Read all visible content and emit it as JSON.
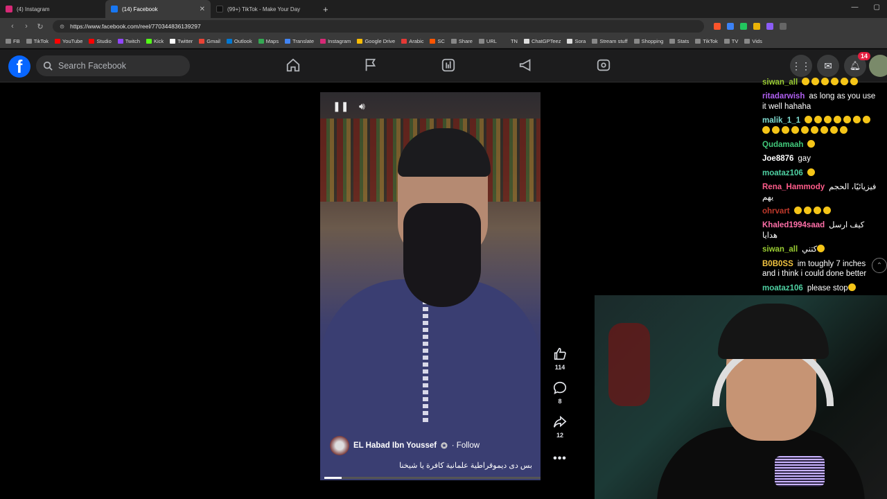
{
  "browser": {
    "tabs": [
      {
        "title": "(4) Instagram",
        "color": "#d62976"
      },
      {
        "title": "(14) Facebook",
        "color": "#1877f2",
        "active": true
      },
      {
        "title": "(99+) TikTok - Make Your Day",
        "color": "#111111"
      }
    ],
    "url": "https://www.facebook.com/reel/770344836139297",
    "bookmarks": [
      {
        "label": "FB",
        "color": "#888"
      },
      {
        "label": "TikTok",
        "color": "#888"
      },
      {
        "label": "YouTube",
        "color": "#ff0000"
      },
      {
        "label": "Studio",
        "color": "#ff0000"
      },
      {
        "label": "Twitch",
        "color": "#9146ff"
      },
      {
        "label": "Kick",
        "color": "#53fc18"
      },
      {
        "label": "Twitter",
        "color": "#ffffff"
      },
      {
        "label": "Gmail",
        "color": "#ea4335"
      },
      {
        "label": "Outlook",
        "color": "#0078d4"
      },
      {
        "label": "Maps",
        "color": "#34a853"
      },
      {
        "label": "Translate",
        "color": "#4285f4"
      },
      {
        "label": "Instagram",
        "color": "#d62976"
      },
      {
        "label": "Google Drive",
        "color": "#fbbc04"
      },
      {
        "label": "Arabic",
        "color": "#e53935"
      },
      {
        "label": "SC",
        "color": "#ff5500"
      },
      {
        "label": "Share",
        "color": "#888"
      },
      {
        "label": "URL",
        "color": "#888"
      },
      {
        "label": "TN",
        "color": "#3a3a3a"
      },
      {
        "label": "ChatGPTeez",
        "color": "#ddd"
      },
      {
        "label": "Sora",
        "color": "#ddd"
      },
      {
        "label": "Stream stuff",
        "color": "#888"
      },
      {
        "label": "Shopping",
        "color": "#888"
      },
      {
        "label": "Stats",
        "color": "#888"
      },
      {
        "label": "TikTok",
        "color": "#888"
      },
      {
        "label": "TV",
        "color": "#888"
      },
      {
        "label": "Vids",
        "color": "#888"
      }
    ]
  },
  "facebook": {
    "search_placeholder": "Search Facebook",
    "notifications_badge": "14",
    "reel": {
      "owner": "EL Habad Ibn Youssef",
      "follow_label": "· Follow",
      "caption": "بس دى ديموقراطية علمانية كافرة يا شيخنا",
      "likes": "114",
      "comments": "8",
      "shares": "12",
      "progress": 0.08
    }
  },
  "chat": [
    {
      "user": "siwan_all",
      "color": "#9acd32",
      "text": "",
      "emotes": 6
    },
    {
      "user": "ritadarwish",
      "color": "#b05ff0",
      "text": "as long as you use it well hahaha",
      "emotes": 0
    },
    {
      "user": "malik_1_1",
      "color": "#7fdcd0",
      "text": "",
      "emotes": 16
    },
    {
      "user": "Qudamaah",
      "color": "#41c87a",
      "text": "",
      "emotes": 1
    },
    {
      "user": "Joe8876",
      "color": "#ffffff",
      "text": "gay",
      "emotes": 0
    },
    {
      "user": "moataz106",
      "color": "#4fd1a3",
      "text": "",
      "emotes": 1
    },
    {
      "user": "Rena_Hammody",
      "color": "#ff5c8a",
      "text": "فيزيائيًا، الحجم يهم",
      "emotes": 0
    },
    {
      "user": "ohrvart",
      "color": "#c0392b",
      "text": "",
      "emotes": 4
    },
    {
      "user": "Khaled1994saad",
      "color": "#ff6fa8",
      "text": "كيف ارسل هدايا",
      "emotes": 0
    },
    {
      "user": "siwan_all",
      "color": "#9acd32",
      "text": "كتني",
      "emotes": 1
    },
    {
      "user": "B0B0SS",
      "color": "#f4c542",
      "text": "im toughly 7 inches and i think i could done better",
      "emotes": 0
    },
    {
      "user": "moataz106",
      "color": "#4fd1a3",
      "text": "please stop",
      "emotes": 1
    }
  ]
}
